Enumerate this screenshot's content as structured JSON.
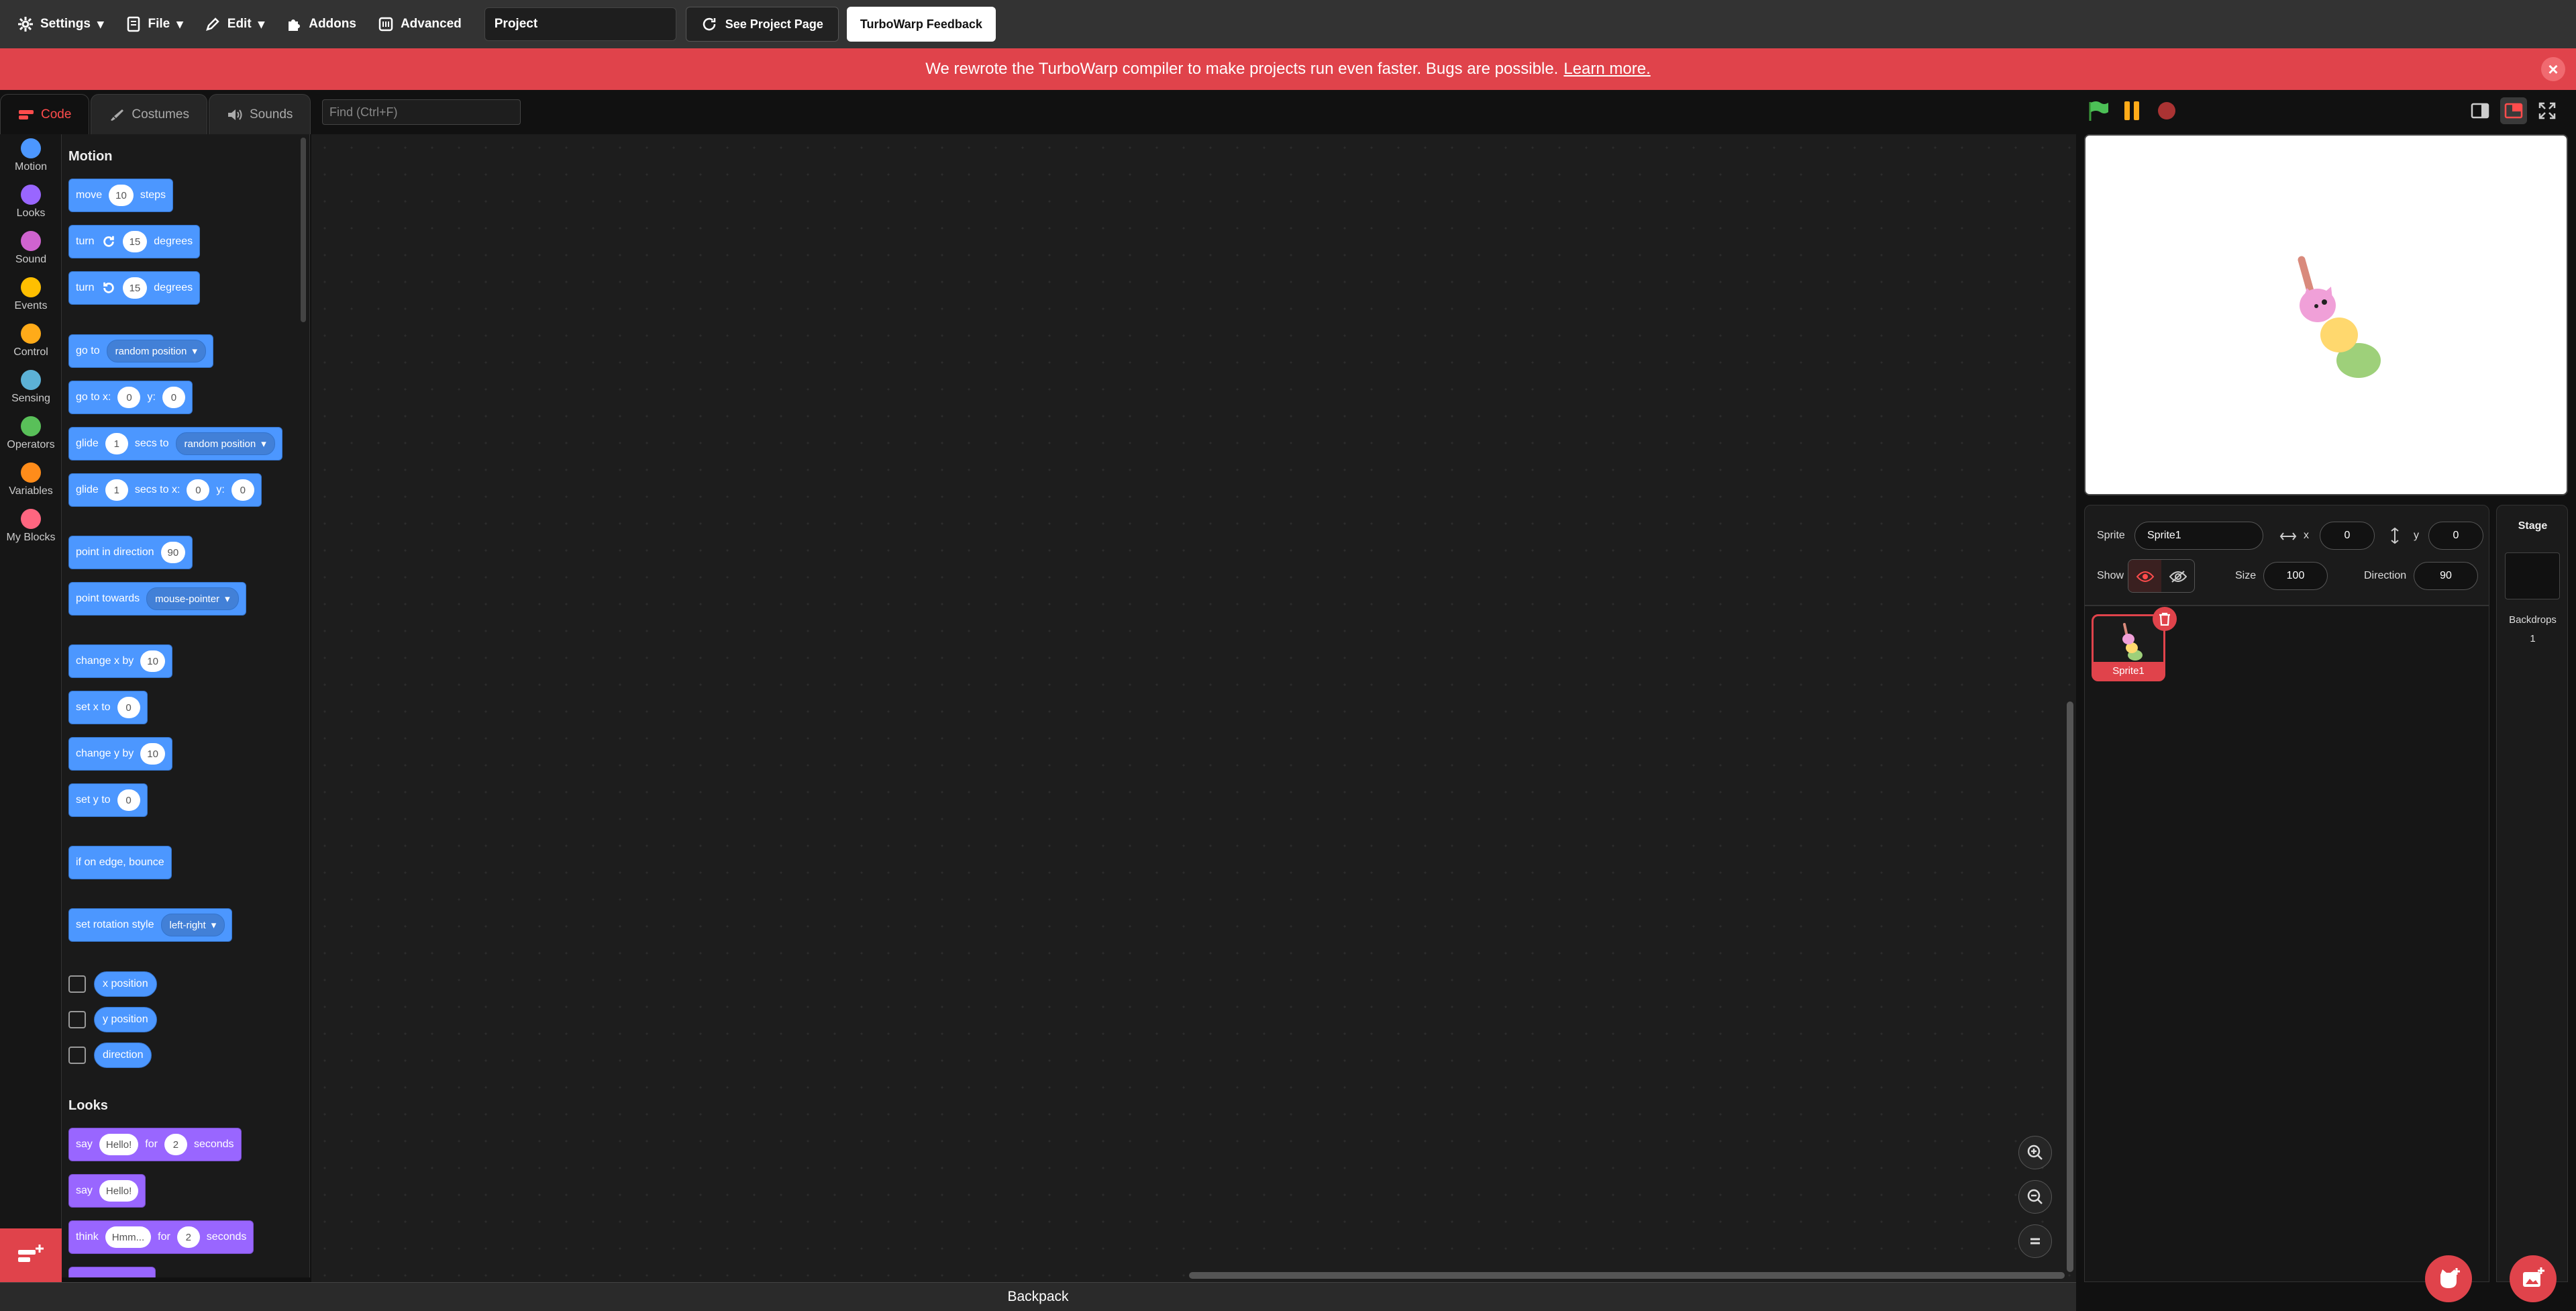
{
  "menubar": {
    "settings": "Settings",
    "file": "File",
    "edit": "Edit",
    "addons": "Addons",
    "advanced": "Advanced",
    "project_title": "Project",
    "see_project_page": "See Project Page",
    "feedback": "TurboWarp Feedback"
  },
  "banner": {
    "message": "We rewrote the TurboWarp compiler to make projects run even faster. Bugs are possible.",
    "link": "Learn more.",
    "close": "×",
    "color": "#e0434b"
  },
  "tabs": {
    "code": "Code",
    "costumes": "Costumes",
    "sounds": "Sounds"
  },
  "find": {
    "placeholder": "Find (Ctrl+F)"
  },
  "categories": [
    {
      "label": "Motion",
      "color": "#4c97ff"
    },
    {
      "label": "Looks",
      "color": "#9966ff"
    },
    {
      "label": "Sound",
      "color": "#cf63cf"
    },
    {
      "label": "Events",
      "color": "#ffbf00"
    },
    {
      "label": "Control",
      "color": "#ffab19"
    },
    {
      "label": "Sensing",
      "color": "#5cb1d6"
    },
    {
      "label": "Operators",
      "color": "#59c059"
    },
    {
      "label": "Variables",
      "color": "#ff8c1a"
    },
    {
      "label": "My Blocks",
      "color": "#ff6680"
    }
  ],
  "palette": {
    "motion_title": "Motion",
    "looks_title": "Looks",
    "move": {
      "a": "move",
      "v": "10",
      "b": "steps"
    },
    "turn_cw": {
      "a": "turn",
      "v": "15",
      "b": "degrees"
    },
    "turn_ccw": {
      "a": "turn",
      "v": "15",
      "b": "degrees"
    },
    "goto": {
      "a": "go to",
      "dd": "random position"
    },
    "gotoxy": {
      "a": "go to x:",
      "x": "0",
      "b": "y:",
      "y": "0"
    },
    "glide": {
      "a": "glide",
      "v": "1",
      "b": "secs to",
      "dd": "random position"
    },
    "glidexy": {
      "a": "glide",
      "v": "1",
      "b": "secs to x:",
      "x": "0",
      "c": "y:",
      "y": "0"
    },
    "point_dir": {
      "a": "point in direction",
      "v": "90"
    },
    "point_towards": {
      "a": "point towards",
      "dd": "mouse-pointer"
    },
    "change_x": {
      "a": "change x by",
      "v": "10"
    },
    "set_x": {
      "a": "set x to",
      "v": "0"
    },
    "change_y": {
      "a": "change y by",
      "v": "10"
    },
    "set_y": {
      "a": "set y to",
      "v": "0"
    },
    "bounce": {
      "a": "if on edge, bounce"
    },
    "rot_style": {
      "a": "set rotation style",
      "dd": "left-right"
    },
    "rep_x": "x position",
    "rep_y": "y position",
    "rep_dir": "direction",
    "say_for": {
      "a": "say",
      "v": "Hello!",
      "b": "for",
      "n": "2",
      "c": "seconds"
    },
    "say": {
      "a": "say",
      "v": "Hello!"
    },
    "think_for": {
      "a": "think",
      "v": "Hmm...",
      "b": "for",
      "n": "2",
      "c": "seconds"
    }
  },
  "backpack": "Backpack",
  "sprite_info": {
    "sprite_label": "Sprite",
    "sprite_name": "Sprite1",
    "x_label": "x",
    "x": "0",
    "y_label": "y",
    "y": "0",
    "show_label": "Show",
    "size_label": "Size",
    "size": "100",
    "direction_label": "Direction",
    "direction": "90"
  },
  "sprites": [
    {
      "name": "Sprite1"
    }
  ],
  "stage_selector": {
    "title": "Stage",
    "backdrops_label": "Backdrops",
    "backdrops_count": "1"
  }
}
